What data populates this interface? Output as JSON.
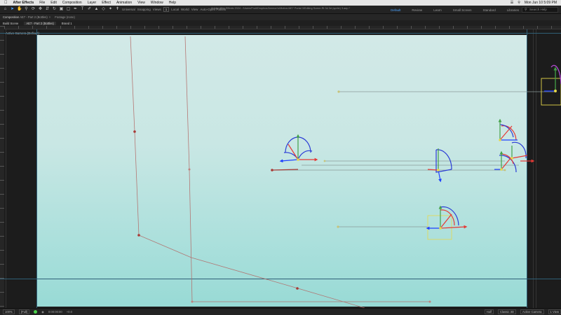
{
  "menubar": {
    "apple": "",
    "app_name": "After Effects",
    "items": [
      "File",
      "Edit",
      "Composition",
      "Layer",
      "Effect",
      "Animation",
      "View",
      "Window",
      "Help"
    ],
    "clock": "Mon Jun 10 5:09 PM"
  },
  "window_title": "Adobe After Effects 2024 - /Users/Fruit/Dropbox/Ammon's/Motion/AE7 Portal 3/Editing Scene-Rt 3d 3d (sprite) 3.aep *",
  "toolbar": {
    "tools": [
      "home-icon",
      "select-icon",
      "hand-icon",
      "zoom-icon",
      "orbit-icon",
      "pan-icon",
      "dolly-icon",
      "pen-icon",
      "rect-icon",
      "text-icon",
      "brush-icon",
      "stamp-icon",
      "eraser-icon",
      "roto-icon",
      "puppet-icon"
    ],
    "universal": "Universal",
    "snapping": "Snapping",
    "view_label": "Views",
    "view_value": "1",
    "camera_options": [
      "Local",
      "World",
      "View"
    ],
    "auto_open_panels": "Auto-Open Panels",
    "workspaces": [
      "Default",
      "Review",
      "Learn",
      "Small Screen",
      "Standard",
      "Libraries"
    ],
    "active_workspace": "Default",
    "search_placeholder": "Search Help"
  },
  "panels": {
    "project_tab": "Composition",
    "project_sub": "AE7 - Part 2 (Bottles)",
    "footage_tab": "Footage (none)",
    "comp_tabs": [
      "Build Scene",
      "AE7 - Part 2 (Bottles)",
      "Brand 1"
    ],
    "active_comp_tab": "AE7 - Part 2 (Bottles)"
  },
  "viewer": {
    "camera_label": "Active Camera (Default)",
    "colors": {
      "guide": "#2f5f77",
      "path": "#b36b68",
      "x_axis": "#e53935",
      "y_axis": "#43a047",
      "z_axis": "#1e40ff",
      "rotate": "#2a3bd6",
      "null_box": "#e6d84a"
    }
  },
  "statusbar": {
    "zoom": "100%",
    "resolution": "(Full)",
    "timecode": "0:00:00:00",
    "time_extra": "+0.0",
    "view_mode": "Half",
    "renderer": "Classic 3D",
    "camera": "Active Camera",
    "views": "1 View"
  }
}
